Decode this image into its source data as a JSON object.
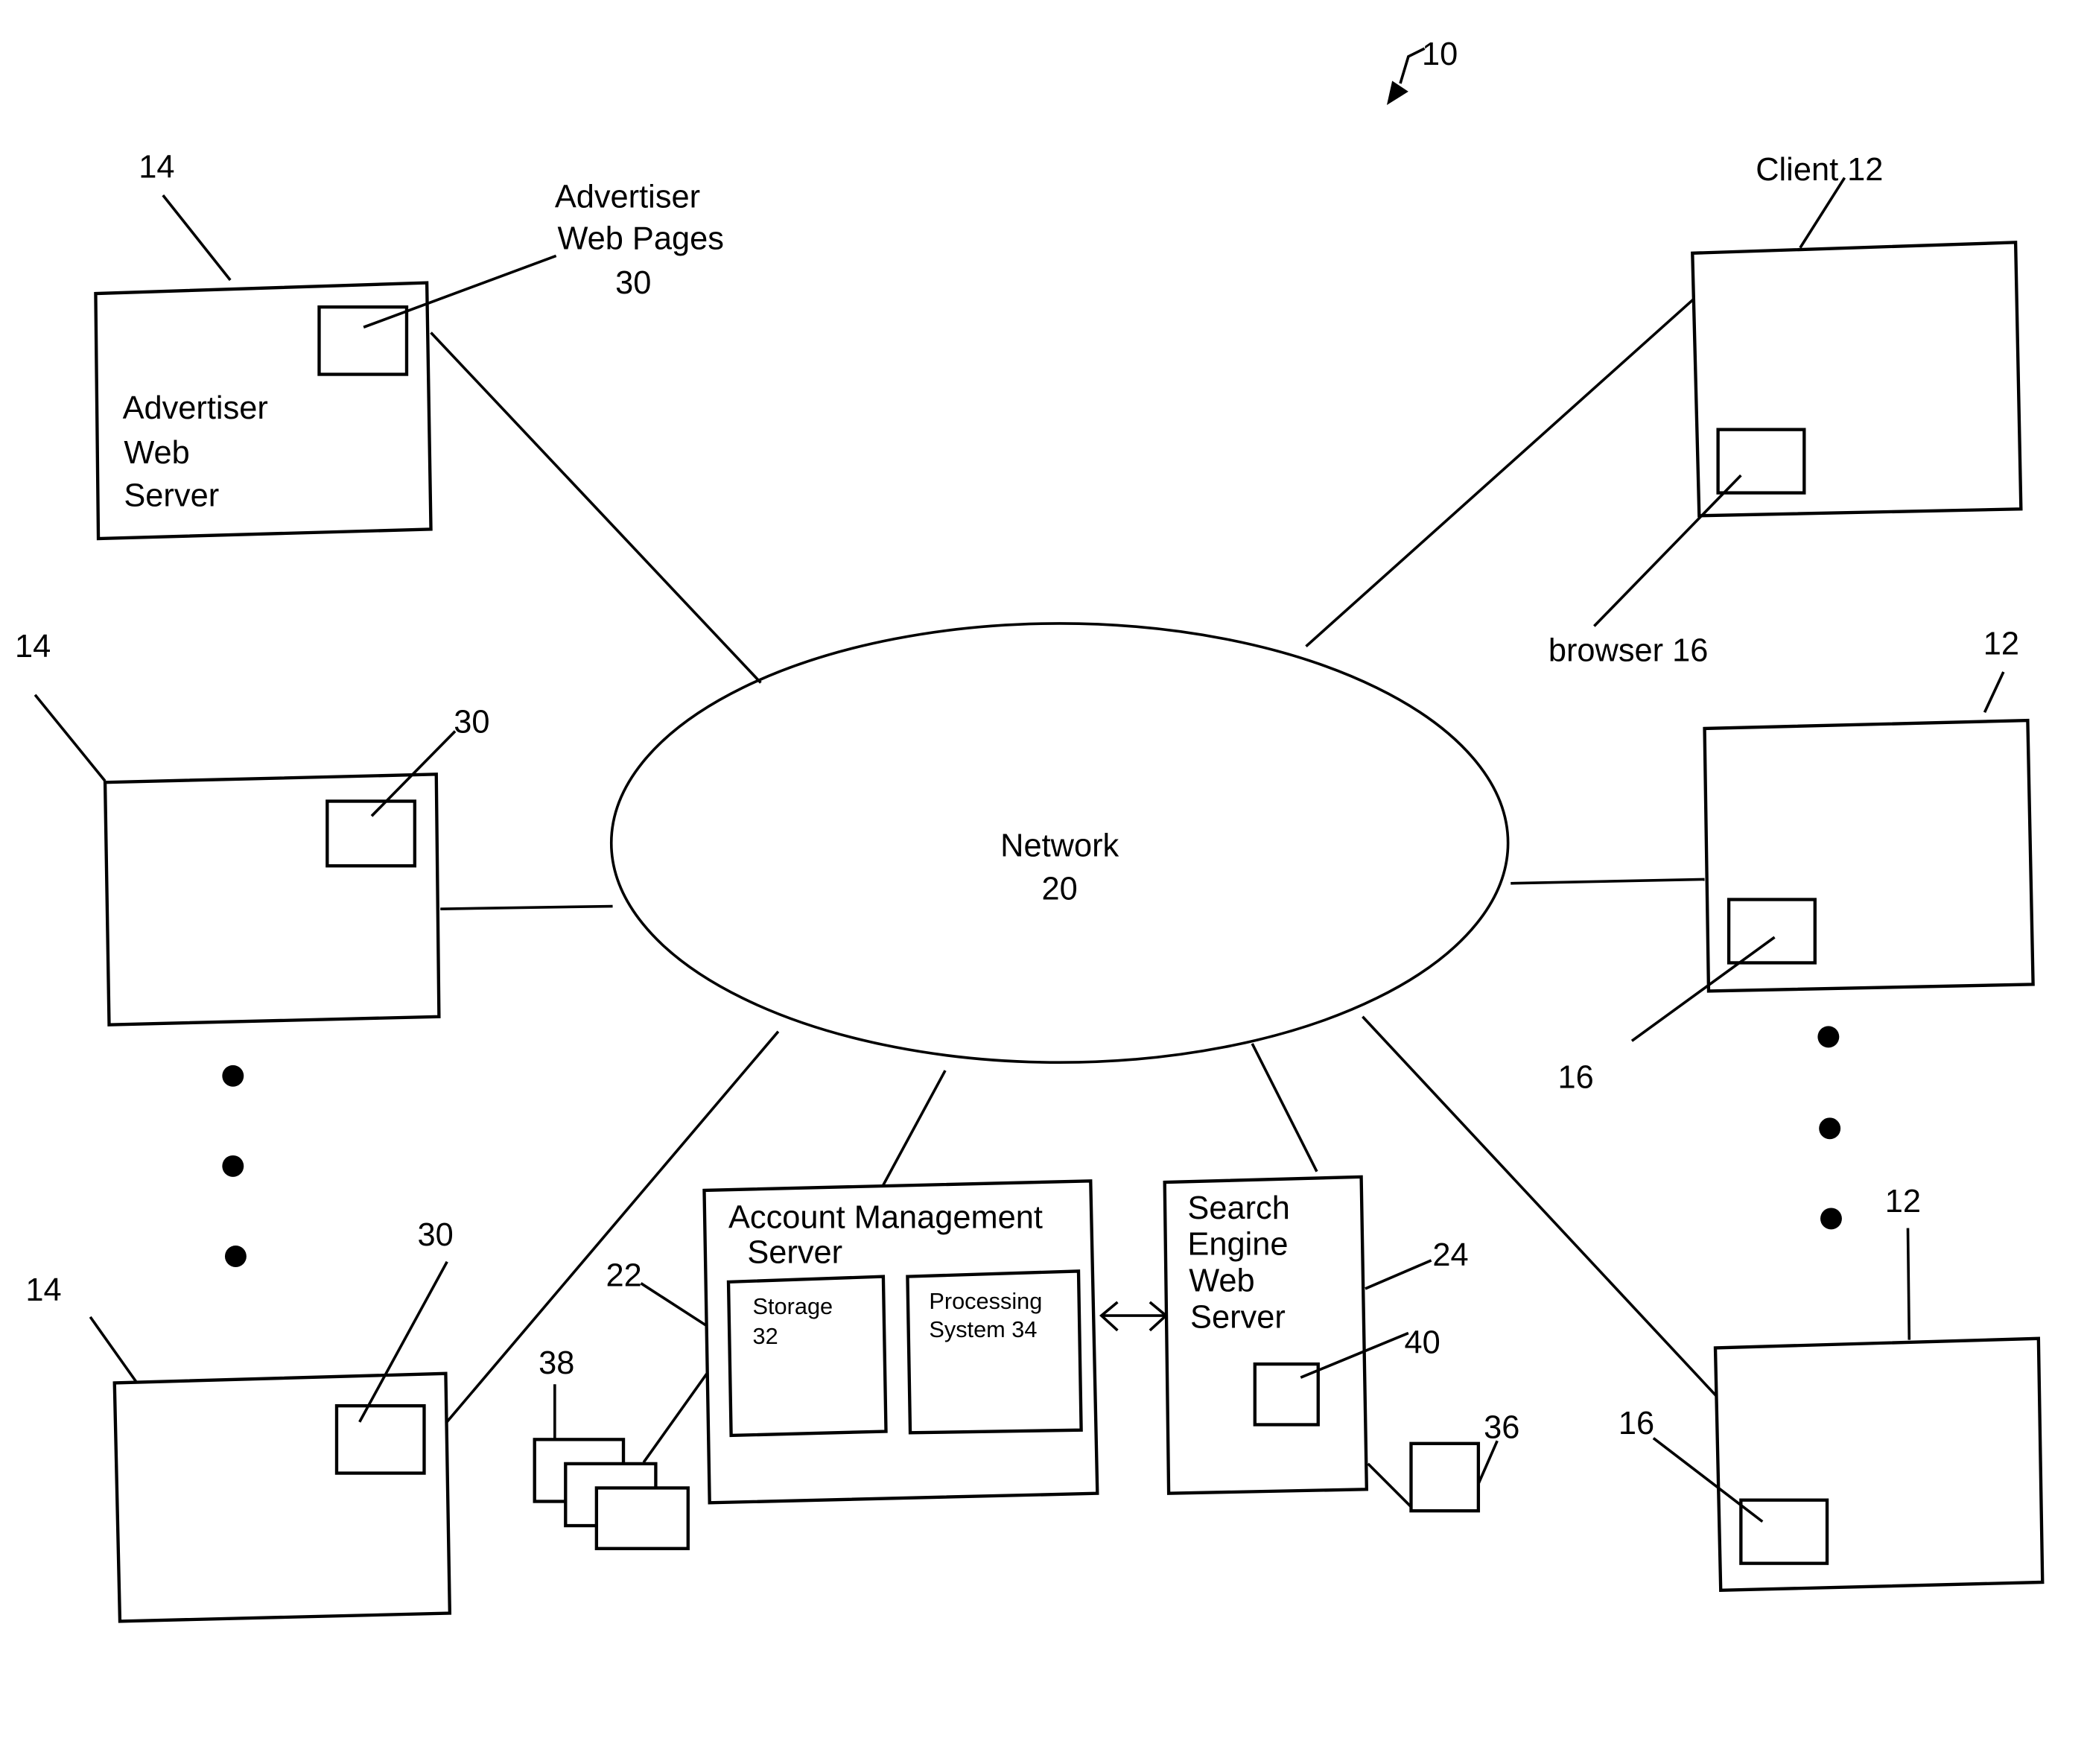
{
  "figure": {
    "ref": "10",
    "network": {
      "label": "Network",
      "ref": "20"
    },
    "advertiser_servers": {
      "label_lines": [
        "Advertiser",
        "Web",
        "Server"
      ],
      "ref": "14",
      "web_pages": {
        "label_lines": [
          "Advertiser",
          "Web Pages"
        ],
        "ref": "30"
      }
    },
    "clients": {
      "label": "Client 12",
      "ref": "12",
      "browser_label": "browser  16",
      "browser_ref": "16"
    },
    "account_management_server": {
      "label_lines": [
        "Account Management",
        "Server"
      ],
      "ref": "22",
      "storage": {
        "label": "Storage",
        "ref": "32"
      },
      "processing": {
        "label_lines": [
          "Processing",
          "System 34"
        ]
      },
      "stack_ref": "38"
    },
    "search_engine_server": {
      "label_lines": [
        "Search",
        "Engine",
        "Web",
        "Server"
      ],
      "ref": "24",
      "component_ref": "40",
      "db_ref": "36"
    }
  }
}
